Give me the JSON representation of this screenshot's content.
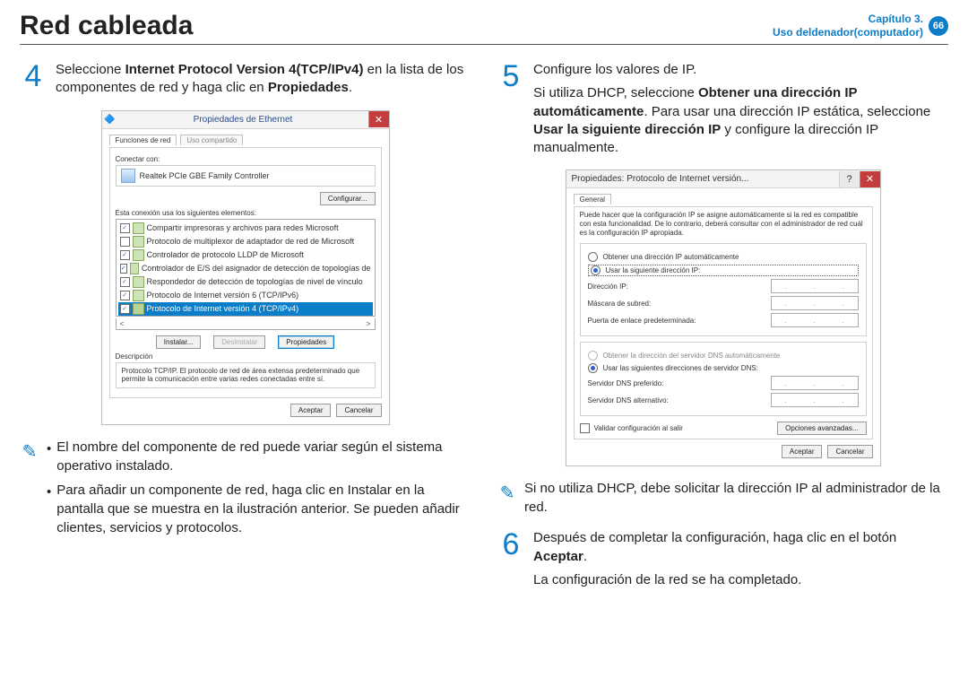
{
  "header": {
    "title": "Red cableada",
    "chapter_line1": "Capítulo 3.",
    "chapter_line2": "Uso deldenador(computador)",
    "page": "66"
  },
  "steps": {
    "s4": {
      "num": "4",
      "pre": "Seleccione ",
      "bold1": "Internet Protocol Version 4(TCP/IPv4)",
      "mid": " en la lista de los componentes de red y haga clic en ",
      "bold2": "Propiedades",
      "post": "."
    },
    "s5": {
      "num": "5",
      "l1": "Configure los valores de IP.",
      "l2a": "Si utiliza DHCP, seleccione ",
      "l2b": "Obtener una dirección IP automáticamente",
      "l2c": ". Para usar una dirección IP estática, seleccione ",
      "l2d": "Usar la siguiente dirección IP",
      "l2e": " y configure la dirección IP manualmente."
    },
    "s6": {
      "num": "6",
      "l1a": "Después de completar la configuración, haga clic en el botón ",
      "l1b": "Aceptar",
      "l1c": ".",
      "l2": "La configuración de la red se ha completado."
    }
  },
  "notes": {
    "n1": {
      "b1": "El nombre del componente de red puede variar según el sistema operativo instalado.",
      "b2": "Para añadir un componente de red, haga clic en Instalar en la pantalla que se muestra en la ilustración anterior. Se pueden añadir clientes, servicios y protocolos."
    },
    "n2": {
      "text": "Si no utiliza DHCP, debe solicitar la dirección IP al administrador de la red."
    }
  },
  "win1": {
    "title": "Propiedades de Ethernet",
    "tab_active": "Funciones de red",
    "tab_inactive": "Uso compartido",
    "connect_label": "Conectar con:",
    "adapter": "Realtek PCIe GBE Family Controller",
    "configure": "Configurar...",
    "elements_label": "Esta conexión usa los siguientes elementos:",
    "items": [
      "Compartir impresoras y archivos para redes Microsoft",
      "Protocolo de multiplexor de adaptador de red de Microsoft",
      "Controlador de protocolo LLDP de Microsoft",
      "Controlador de E/S del asignador de detección de topologías de",
      "Respondedor de detección de topologías de nivel de vínculo",
      "Protocolo de Internet versión 6 (TCP/IPv6)",
      "Protocolo de Internet versión 4 (TCP/IPv4)"
    ],
    "install": "Instalar...",
    "uninstall": "Desinstalar",
    "properties": "Propiedades",
    "desc_label": "Descripción",
    "desc_text": "Protocolo TCP/IP. El protocolo de red de área extensa predeterminado que permite la comunicación entre varias redes conectadas entre sí.",
    "ok": "Aceptar",
    "cancel": "Cancelar"
  },
  "win2": {
    "title": "Propiedades: Protocolo de Internet versión...",
    "tab": "General",
    "help": "Puede hacer que la configuración IP se asigne automáticamente si la red es compatible con esta funcionalidad. De lo contrario, deberá consultar con el administrador de red cuál es la configuración IP apropiada.",
    "r_auto_ip": "Obtener una dirección IP automáticamente",
    "r_manual_ip": "Usar la siguiente dirección IP:",
    "ip_label": "Dirección IP:",
    "mask_label": "Máscara de subred:",
    "gw_label": "Puerta de enlace predeterminada:",
    "r_auto_dns": "Obtener la dirección del servidor DNS automáticamente",
    "r_manual_dns": "Usar las siguientes direcciones de servidor DNS:",
    "dns1": "Servidor DNS preferido:",
    "dns2": "Servidor DNS alternativo:",
    "validate": "Validar configuración al salir",
    "advanced": "Opciones avanzadas...",
    "ok": "Aceptar",
    "cancel": "Cancelar"
  }
}
